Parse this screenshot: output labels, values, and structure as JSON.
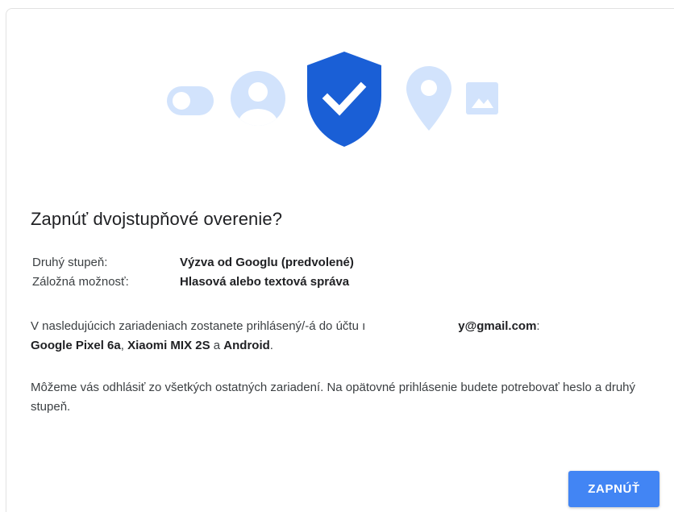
{
  "dialog": {
    "title": "Zapnúť dvojstupňové overenie?",
    "settings": [
      {
        "label": "Druhý stupeň:",
        "value": "Výzva od Googlu (predvolené)"
      },
      {
        "label": "Záložná možnosť:",
        "value": "Hlasová alebo textová správa"
      }
    ],
    "devices_paragraph": {
      "intro": "V nasledujúcich zariadeniach zostanete prihlásený/-á do účtu ",
      "email_prefix": "ı",
      "email_suffix": "y@gmail.com",
      "colon": ":",
      "devices": [
        "Google Pixel 6a",
        "Xiaomi MIX 2S",
        "Android"
      ],
      "separator_1": ", ",
      "separator_2": " a ",
      "end": "."
    },
    "signout_paragraph": "Môžeme vás odhlásiť zo všetkých ostatných zariadení. Na opätovné prihlásenie budete potrebovať heslo a druhý stupeň.",
    "confirm_button": "ZAPNÚŤ"
  },
  "hero_icons": [
    "toggle-icon",
    "account-icon",
    "shield-check-icon",
    "location-pin-icon",
    "image-icon"
  ],
  "colors": {
    "accent": "#4285f4",
    "shield": "#1a5fd6",
    "icon_light": "#d2e3fc",
    "title_text": "#202124",
    "body_text": "#3c4043"
  }
}
